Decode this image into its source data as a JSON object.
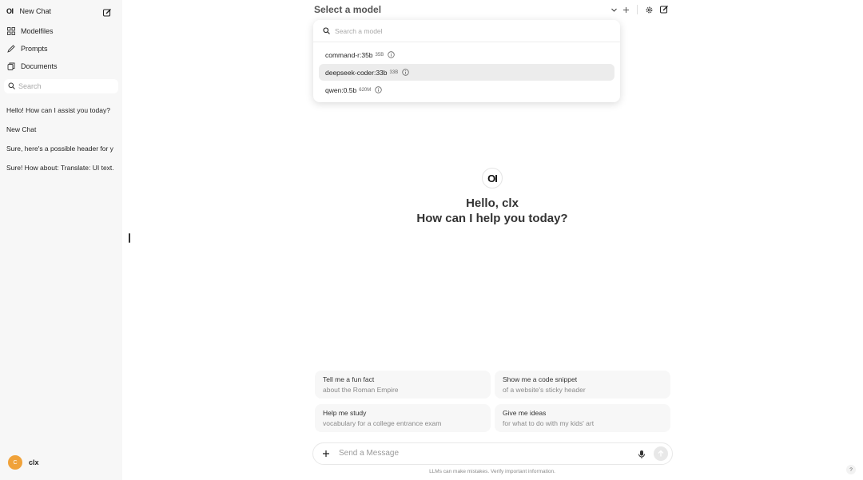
{
  "sidebar": {
    "logo": "OI",
    "new_chat_label": "New Chat",
    "nav": [
      {
        "label": "Modelfiles",
        "icon": "grid-icon"
      },
      {
        "label": "Prompts",
        "icon": "pencil-icon"
      },
      {
        "label": "Documents",
        "icon": "documents-icon"
      }
    ],
    "search_placeholder": "Search",
    "chats": [
      "Hello! How can I assist you today?",
      "New Chat",
      "Sure, here's a possible header for y",
      "Sure! How about: Translate: UI text."
    ],
    "user": {
      "initial": "C",
      "name": "clx",
      "avatar_color": "#f0a23a"
    }
  },
  "header": {
    "model_selector_label": "Select a model"
  },
  "model_dropdown": {
    "search_placeholder": "Search a model",
    "models": [
      {
        "name": "command-r:35b",
        "size": "35B",
        "selected": false
      },
      {
        "name": "deepseek-coder:33b",
        "size": "33B",
        "selected": true
      },
      {
        "name": "qwen:0.5b",
        "size": "620M",
        "selected": false
      }
    ]
  },
  "main": {
    "logo": "OI",
    "greeting_line1": "Hello, clx",
    "greeting_line2": "How can I help you today?",
    "suggestions": [
      {
        "title": "Tell me a fun fact",
        "subtitle": "about the Roman Empire"
      },
      {
        "title": "Show me a code snippet",
        "subtitle": "of a website's sticky header"
      },
      {
        "title": "Help me study",
        "subtitle": "vocabulary for a college entrance exam"
      },
      {
        "title": "Give me ideas",
        "subtitle": "for what to do with my kids' art"
      }
    ],
    "message_placeholder": "Send a Message",
    "disclaimer": "LLMs can make mistakes. Verify important information.",
    "help_label": "?"
  }
}
